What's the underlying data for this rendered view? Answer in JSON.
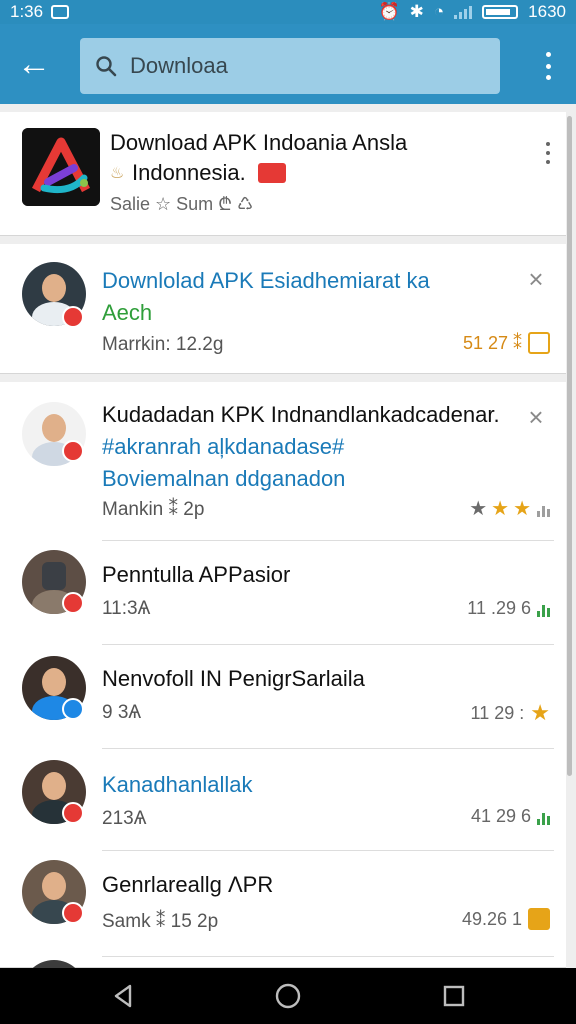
{
  "status_bar": {
    "time": "1:36",
    "battery_text": "1630"
  },
  "search": {
    "value": "Downloaa"
  },
  "app_card": {
    "title": "Download APK Indoania Ansla",
    "subtitle": "Indonnesia.",
    "meta": "Salie ☆ Sum ₾ ♺"
  },
  "items": [
    {
      "title": "Downlolad APK Esiadhemiarat ka",
      "line2": "Aech",
      "meta": "Marrkin: 12.2g",
      "right_text": "51 27 ⁑",
      "avatar_icon": "person-avatar",
      "badge_color": "#e53935"
    },
    {
      "title": "Kudadadan KPK Indnandlankadcadenar.",
      "line2": "#akranrah aļkdanadase#",
      "line3": "Boviemalnan ddganadon",
      "meta": "Mankin ⁑ 2p",
      "rating": 3,
      "badge_color": "#e53935"
    },
    {
      "title": "Penntulla APPasior",
      "meta": "11:3Ѧ",
      "right_text": "11 .29 6",
      "badge_color": "#e53935"
    },
    {
      "title": "Nenvofoll IN PenigrSarlaila",
      "meta": "9 3Ѧ",
      "right_text": "11 29 :",
      "badge_color": "#1e88e5"
    },
    {
      "title": "Kanadhanlallak",
      "meta": "213Ѧ",
      "right_text": "41 29 6",
      "badge_color": "#e53935"
    },
    {
      "title": "Genrlareallg ΛPR",
      "meta": "Samk ⁑ 15 2p",
      "right_text": "49.26 1",
      "badge_color": "#e53935"
    }
  ],
  "colors": {
    "app_bar": "#2e90c2",
    "accent_blue": "#1a7ab8",
    "accent_green": "#2f9e3a",
    "gold": "#e6a418"
  },
  "icons": {
    "back": "arrow-left-icon",
    "search": "search-icon",
    "overflow": "more-vertical-icon",
    "close": "close-icon",
    "nav_back": "triangle-back-icon",
    "nav_home": "circle-home-icon",
    "nav_recent": "square-recent-icon"
  }
}
